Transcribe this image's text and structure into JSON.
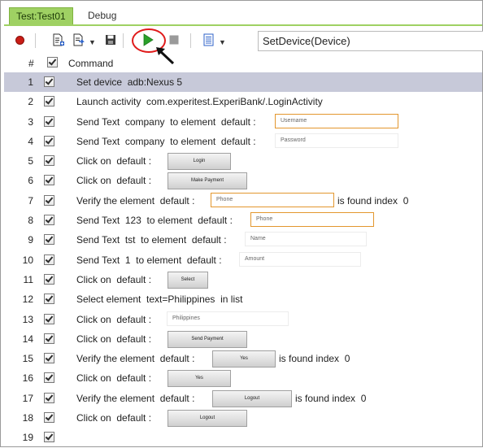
{
  "tabs": [
    {
      "label": "Test:Test01",
      "active": true
    },
    {
      "label": "Debug",
      "active": false
    }
  ],
  "toolbar": {
    "command_value": "SetDevice(Device)",
    "icons": [
      "record-icon",
      "new-step-icon",
      "export-icon",
      "save-icon",
      "play-icon",
      "stop-icon",
      "document-icon"
    ]
  },
  "table": {
    "header_num": "#",
    "header_command": "Command"
  },
  "colors": {
    "tab_green": "#9fd163",
    "selected_row": "#c7c9d9",
    "highlight_orange": "#e3972e",
    "annotation_red": "#e01b1b",
    "play_green": "#2aa02a"
  },
  "rows": [
    {
      "num": "1",
      "a": "Set device  adb:Nexus 5",
      "selected": true
    },
    {
      "num": "2",
      "a": "Launch activity  com.experitest.ExperiBank/.LoginActivity"
    },
    {
      "num": "3",
      "a": "Send Text  company  to element  default :",
      "field": "Username"
    },
    {
      "num": "4",
      "a": "Send Text  company  to element  default :",
      "field": "Password"
    },
    {
      "num": "5",
      "a": "Click on  default :",
      "button": "Login"
    },
    {
      "num": "6",
      "a": "Click on  default :",
      "button": "Make Payment"
    },
    {
      "num": "7",
      "a": "Verify the element  default :",
      "field": "Phone",
      "b": "is found index  0"
    },
    {
      "num": "8",
      "a": "Send Text  123  to element  default :",
      "field": "Phone"
    },
    {
      "num": "9",
      "a": "Send Text  tst  to element  default :",
      "field": "Name"
    },
    {
      "num": "10",
      "a": "Send Text  1  to element  default :",
      "field": "Amount"
    },
    {
      "num": "11",
      "a": "Click on  default :",
      "button": "Select"
    },
    {
      "num": "12",
      "a": "Select element  text=Philippines  in list"
    },
    {
      "num": "13",
      "a": "Click on  default :",
      "field": "Philippines"
    },
    {
      "num": "14",
      "a": "Click on  default :",
      "button": "Send Payment"
    },
    {
      "num": "15",
      "a": "Verify the element  default :",
      "button": "Yes",
      "b": "is found index  0"
    },
    {
      "num": "16",
      "a": "Click on  default :",
      "button": "Yes"
    },
    {
      "num": "17",
      "a": "Verify the element  default :",
      "button": "Logout",
      "b": "is found index  0"
    },
    {
      "num": "18",
      "a": "Click on  default :",
      "button": "Logout"
    },
    {
      "num": "19",
      "a": ""
    }
  ]
}
